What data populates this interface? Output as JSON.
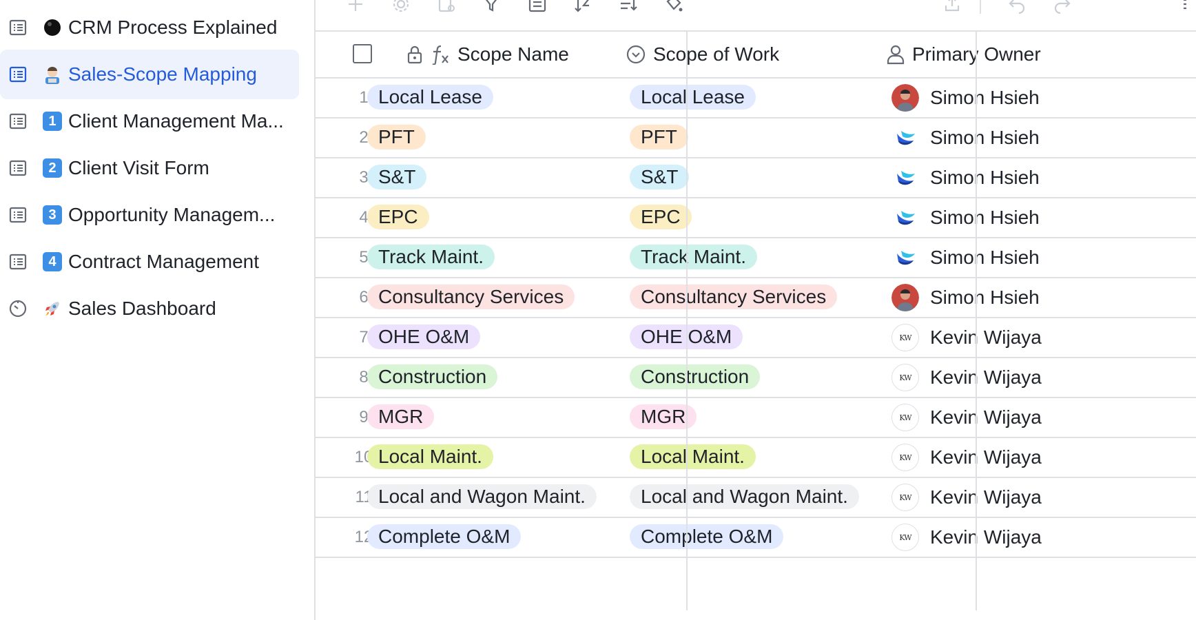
{
  "sidebar": {
    "items": [
      {
        "label": "CRM Process Explained",
        "icon": "table-icon",
        "emoji": "black-circle",
        "emoji_text": "",
        "active": false
      },
      {
        "label": "Sales-Scope Mapping",
        "icon": "table-icon",
        "emoji": "man-technologist",
        "emoji_text": "",
        "active": true
      },
      {
        "label": "Client Management Ma...",
        "icon": "table-icon",
        "emoji": "keycap-1",
        "emoji_text": "1",
        "active": false
      },
      {
        "label": "Client Visit Form",
        "icon": "table-icon",
        "emoji": "keycap-2",
        "emoji_text": "2",
        "active": false
      },
      {
        "label": "Opportunity Managem...",
        "icon": "table-icon",
        "emoji": "keycap-3",
        "emoji_text": "3",
        "active": false
      },
      {
        "label": "Contract Management",
        "icon": "table-icon",
        "emoji": "keycap-4",
        "emoji_text": "4",
        "active": false
      },
      {
        "label": "Sales Dashboard",
        "icon": "dashboard-icon",
        "emoji": "rocket",
        "emoji_text": "",
        "active": false
      }
    ]
  },
  "table": {
    "columns": [
      {
        "label": "Scope Name",
        "icons": [
          "lock-icon",
          "formula-icon"
        ]
      },
      {
        "label": "Scope of Work",
        "icons": [
          "single-select-icon"
        ]
      },
      {
        "label": "Primary Owner",
        "icons": [
          "person-icon"
        ]
      }
    ],
    "rows": [
      {
        "num": "1",
        "scope_name": "Local Lease",
        "scope_of_work": "Local Lease",
        "owner": "Simon Hsieh",
        "avatar": "photo",
        "color": "#e1eaff"
      },
      {
        "num": "2",
        "scope_name": "PFT",
        "scope_of_work": "PFT",
        "owner": "Simon Hsieh",
        "avatar": "logo",
        "color": "#fee7cd"
      },
      {
        "num": "3",
        "scope_name": "S&T",
        "scope_of_work": "S&T",
        "owner": "Simon Hsieh",
        "avatar": "logo",
        "color": "#d4f1fb"
      },
      {
        "num": "4",
        "scope_name": "EPC",
        "scope_of_work": "EPC",
        "owner": "Simon Hsieh",
        "avatar": "logo",
        "color": "#fbeec2"
      },
      {
        "num": "5",
        "scope_name": "Track Maint.",
        "scope_of_work": "Track Maint.",
        "owner": "Simon Hsieh",
        "avatar": "logo",
        "color": "#cdf2ec"
      },
      {
        "num": "6",
        "scope_name": "Consultancy Services",
        "scope_of_work": "Consultancy Services",
        "owner": "Simon Hsieh",
        "avatar": "photo",
        "color": "#fde2e2"
      },
      {
        "num": "7",
        "scope_name": "OHE O&M",
        "scope_of_work": "OHE O&M",
        "owner": "Kevin Wijaya",
        "avatar": "kw",
        "color": "#ece2fe"
      },
      {
        "num": "8",
        "scope_name": "Construction",
        "scope_of_work": "Construction",
        "owner": "Kevin Wijaya",
        "avatar": "kw",
        "color": "#d9f5d6"
      },
      {
        "num": "9",
        "scope_name": "MGR",
        "scope_of_work": "MGR",
        "owner": "Kevin Wijaya",
        "avatar": "kw",
        "color": "#fde1ef"
      },
      {
        "num": "10",
        "scope_name": "Local Maint.",
        "scope_of_work": "Local Maint.",
        "owner": "Kevin Wijaya",
        "avatar": "kw",
        "color": "#e4f3a5"
      },
      {
        "num": "11",
        "scope_name": "Local and Wagon Maint.",
        "scope_of_work": "Local and Wagon Maint.",
        "owner": "Kevin Wijaya",
        "avatar": "kw",
        "color": "#eff0f1"
      },
      {
        "num": "12",
        "scope_name": "Complete O&M",
        "scope_of_work": "Complete O&M",
        "owner": "Kevin Wijaya",
        "avatar": "kw",
        "color": "#e1eaff"
      }
    ],
    "avatar_initials": "KW"
  },
  "toolbar": {
    "icons": [
      "add-icon",
      "settings-icon",
      "field-settings-icon",
      "filter-icon",
      "group-icon",
      "sort-icon",
      "row-height-icon",
      "paint-icon",
      "share-icon",
      "undo-icon",
      "redo-icon",
      "more-icon"
    ]
  },
  "colors": {
    "accent": "#245bdb",
    "active_bg": "#eef2fd",
    "border": "#dee0e3"
  }
}
